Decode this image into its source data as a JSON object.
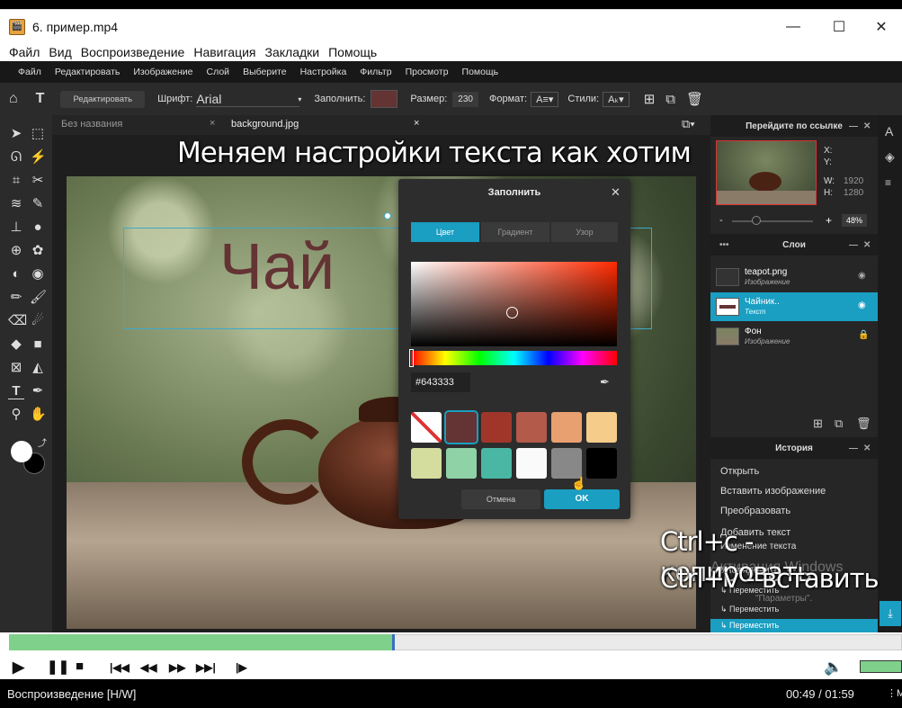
{
  "window": {
    "title": "6. пример.mp4",
    "icon": "film-clapper-icon",
    "minimize": "—",
    "maximize": "☐",
    "close": "✕"
  },
  "player_menu": [
    "Файл",
    "Вид",
    "Воспроизведение",
    "Навигация",
    "Закладки",
    "Помощь"
  ],
  "editor_menu": [
    "Файл",
    "Редактировать",
    "Изображение",
    "Слой",
    "Выберите",
    "Настройка",
    "Фильтр",
    "Просмотр",
    "Помощь"
  ],
  "toolbar": {
    "edit_button": "Редактировать",
    "font_label": "Шрифт:",
    "font_value": "Arial",
    "fill_label": "Заполнить:",
    "fill_color": "#643333",
    "size_label": "Размер:",
    "size_value": "230",
    "format_label": "Формат:",
    "style_label": "Стили:"
  },
  "tabs": [
    {
      "label": "Без названия",
      "close": "×"
    },
    {
      "label": "background.jpg",
      "close": "×"
    }
  ],
  "caption_top": "Меняем настройки текста как хотим",
  "canvas_text": "Чай",
  "dialog": {
    "title": "Заполнить",
    "close": "✕",
    "tabs": [
      "Цвет",
      "Градиент",
      "Узор"
    ],
    "hex": "#643333",
    "swatches_row1": [
      "none",
      "#643333",
      "#a0362a",
      "#b35a4a",
      "#e8a070",
      "#f5cc8a"
    ],
    "swatches_row2": [
      "#d4dc9e",
      "#8ed2a6",
      "#49b7a4",
      "#fafafa",
      "#888888",
      "#000000"
    ],
    "cancel": "Отмена",
    "ok": "OK"
  },
  "navigator": {
    "title": "Перейдите по ссылке",
    "x_label": "X:",
    "y_label": "Y:",
    "w_label": "W:",
    "w_value": "1920",
    "h_label": "H:",
    "h_value": "1280",
    "zoom": "48%",
    "minus": "-",
    "plus": "+"
  },
  "layers": {
    "title": "Слои",
    "items": [
      {
        "name": "teapot.png",
        "sub": "Изображение",
        "icon": "eye-icon"
      },
      {
        "name": "Чайник..",
        "sub": "Текст",
        "icon": "eye-icon"
      },
      {
        "name": "Фон",
        "sub": "Изображение",
        "icon": "lock-icon"
      }
    ]
  },
  "history": {
    "title": "История",
    "items": [
      "Открыть",
      "Вставить изображение",
      "Преобразовать",
      "Добавить текст",
      "Изменение текста",
      "Упорядочить",
      "↳ Переместить",
      "↳ Переместить",
      "↳ Переместить"
    ]
  },
  "overlay": {
    "copy": "Ctrl+c - копировать",
    "paste": "Ctrl+v - вставить",
    "watermark": "Активация Windows",
    "watermark_sub": "\"Параметры\"."
  },
  "playback": {
    "status": "Воспроизведение [H/W]",
    "time": "00:49 / 01:59",
    "progress": 0.43,
    "volume_icon": "speaker-icon"
  }
}
